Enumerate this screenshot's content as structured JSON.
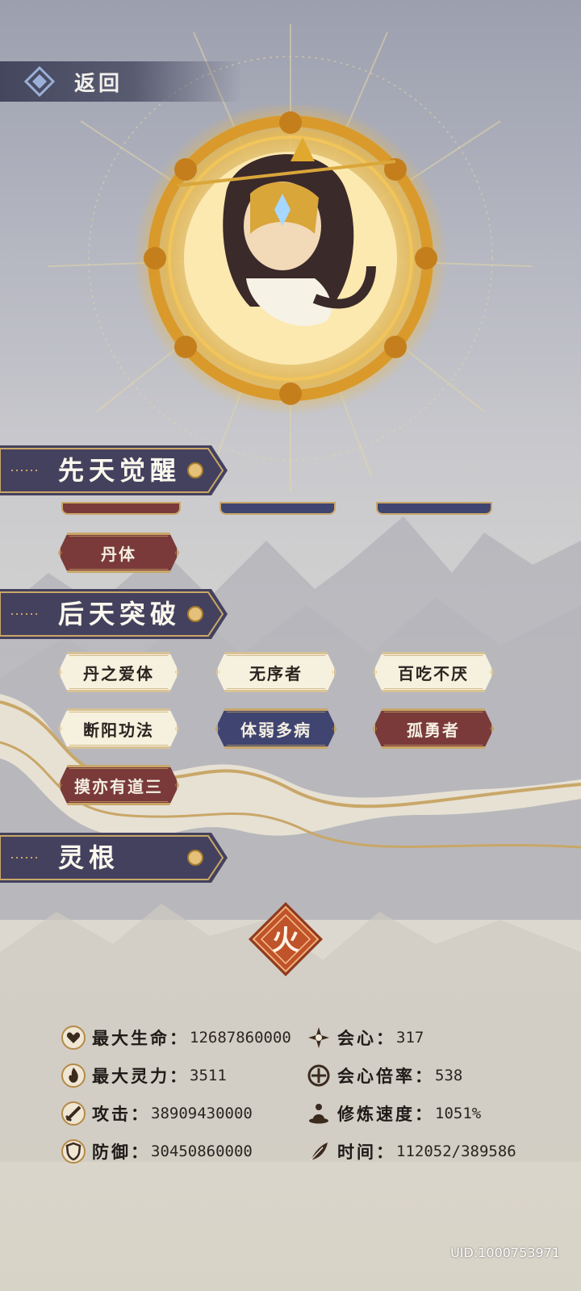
{
  "header": {
    "back_label": "返回"
  },
  "sections": {
    "innate": {
      "title": "先天觉醒",
      "tags": [
        {
          "label": "丹体",
          "style": "red"
        }
      ]
    },
    "acquired": {
      "title": "后天突破",
      "tags": [
        {
          "label": "丹之爱体",
          "style": "cream"
        },
        {
          "label": "无序者",
          "style": "cream"
        },
        {
          "label": "百吃不厌",
          "style": "cream"
        },
        {
          "label": "断阳功法",
          "style": "cream"
        },
        {
          "label": "体弱多病",
          "style": "blue"
        },
        {
          "label": "孤勇者",
          "style": "red"
        },
        {
          "label": "摸亦有道三",
          "style": "red"
        }
      ]
    },
    "spirit_root": {
      "title": "灵根",
      "element": "火"
    }
  },
  "stats": [
    {
      "icon": "heart-icon",
      "label": "最大生命",
      "value": "12687860000"
    },
    {
      "icon": "crit-star-icon",
      "label": "会心",
      "value": "317"
    },
    {
      "icon": "flame-icon",
      "label": "最大灵力",
      "value": "3511"
    },
    {
      "icon": "crit-ratio-icon",
      "label": "会心倍率",
      "value": "538"
    },
    {
      "icon": "sword-icon",
      "label": "攻击",
      "value": "38909430000"
    },
    {
      "icon": "meditate-icon",
      "label": "修炼速度",
      "value": "1051%"
    },
    {
      "icon": "shield-icon",
      "label": "防御",
      "value": "30450860000"
    },
    {
      "icon": "feather-icon",
      "label": "时间",
      "value": "112052/389586"
    }
  ],
  "uid": "UID:1000753971",
  "colors": {
    "gold": "#c9a768",
    "header_bg": "#3c3e56",
    "tag_red": "#7a3a3a",
    "tag_blue": "#3f4470",
    "tag_cream": "#f6f0de",
    "fire": "#c0532a"
  }
}
